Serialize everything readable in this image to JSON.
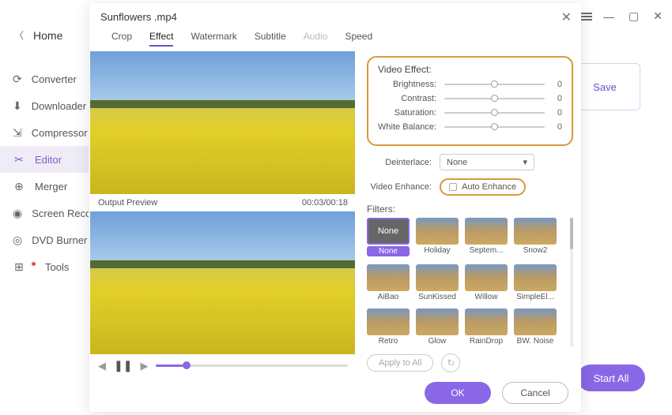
{
  "window": {
    "title": "Sunflowers .mp4"
  },
  "sidebar": {
    "home": "Home",
    "items": [
      {
        "label": "Converter",
        "icon": "converter-icon"
      },
      {
        "label": "Downloader",
        "icon": "downloader-icon"
      },
      {
        "label": "Compressor",
        "icon": "compressor-icon"
      },
      {
        "label": "Editor",
        "icon": "editor-icon",
        "active": true
      },
      {
        "label": "Merger",
        "icon": "merger-icon"
      },
      {
        "label": "Screen Record",
        "icon": "screen-record-icon"
      },
      {
        "label": "DVD Burner",
        "icon": "dvd-burner-icon"
      },
      {
        "label": "Tools",
        "icon": "tools-icon",
        "badge": true
      }
    ]
  },
  "bg": {
    "save": "Save",
    "start_all": "Start All"
  },
  "tabs": {
    "crop": "Crop",
    "effect": "Effect",
    "watermark": "Watermark",
    "subtitle": "Subtitle",
    "audio": "Audio",
    "speed": "Speed"
  },
  "preview": {
    "label": "Output Preview",
    "time": "00:03/00:18"
  },
  "video_effect": {
    "title": "Video Effect:",
    "brightness_label": "Brightness:",
    "brightness_value": "0",
    "contrast_label": "Contrast:",
    "contrast_value": "0",
    "saturation_label": "Saturation:",
    "saturation_value": "0",
    "white_balance_label": "White Balance:",
    "white_balance_value": "0"
  },
  "deinterlace": {
    "label": "Deinterlace:",
    "value": "None"
  },
  "enhance": {
    "label": "Video Enhance:",
    "auto": "Auto Enhance"
  },
  "filters": {
    "label": "Filters:",
    "none_thumb": "None",
    "items": [
      "None",
      "Holiday",
      "Septem...",
      "Snow2",
      "AiBao",
      "SunKissed",
      "Willow",
      "SimpleEl...",
      "Retro",
      "Glow",
      "RainDrop",
      "BW. Noise"
    ],
    "apply": "Apply to All"
  },
  "footer": {
    "ok": "OK",
    "cancel": "Cancel"
  }
}
